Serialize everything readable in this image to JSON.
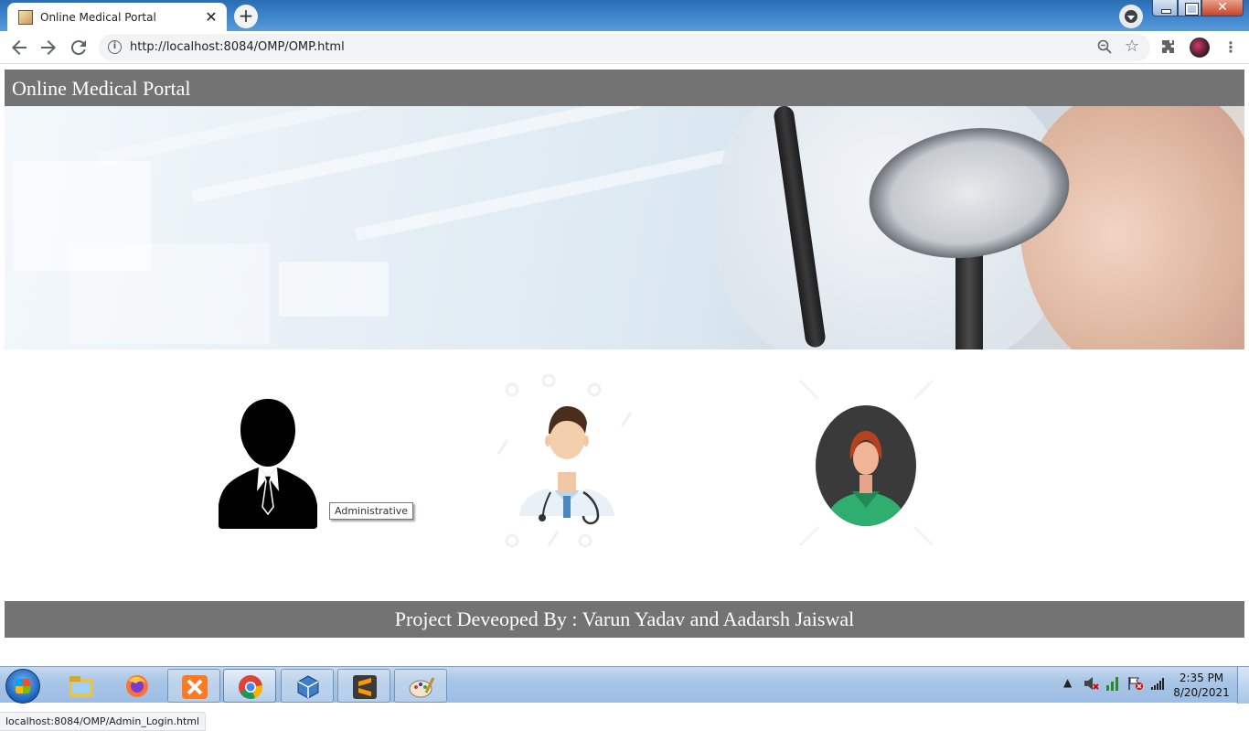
{
  "browser": {
    "tab_title": "Online Medical Portal",
    "tab_close": "✕",
    "new_tab": "+",
    "url": "http://localhost:8084/OMP/OMP.html",
    "info_glyph": "i",
    "icons": [
      "back-icon",
      "forward-icon",
      "reload-icon",
      "info-icon",
      "zoom-icon",
      "star-icon",
      "extensions-icon",
      "profile-avatar",
      "menu-icon"
    ]
  },
  "page": {
    "header_title": "Online Medical Portal",
    "roles": [
      {
        "name": "Administrative",
        "icon": "admin-silhouette-icon"
      },
      {
        "name": "Doctor",
        "icon": "doctor-icon"
      },
      {
        "name": "Patient",
        "icon": "patient-icon"
      }
    ],
    "hover_tooltip": "Administrative",
    "footer_text": "Project Deveoped By : Varun Yadav and Aadarsh Jaiswal"
  },
  "status_url": "localhost:8084/OMP/Admin_Login.html",
  "taskbar": {
    "apps": [
      "windows-explorer",
      "firefox",
      "xampp",
      "chrome",
      "virtualbox",
      "sublime-text",
      "paint"
    ],
    "active_app": "chrome",
    "clock_time": "2:35 PM",
    "clock_date": "8/20/2021"
  },
  "colors": {
    "header_bg": "#737373",
    "header_text": "#ffffff"
  }
}
